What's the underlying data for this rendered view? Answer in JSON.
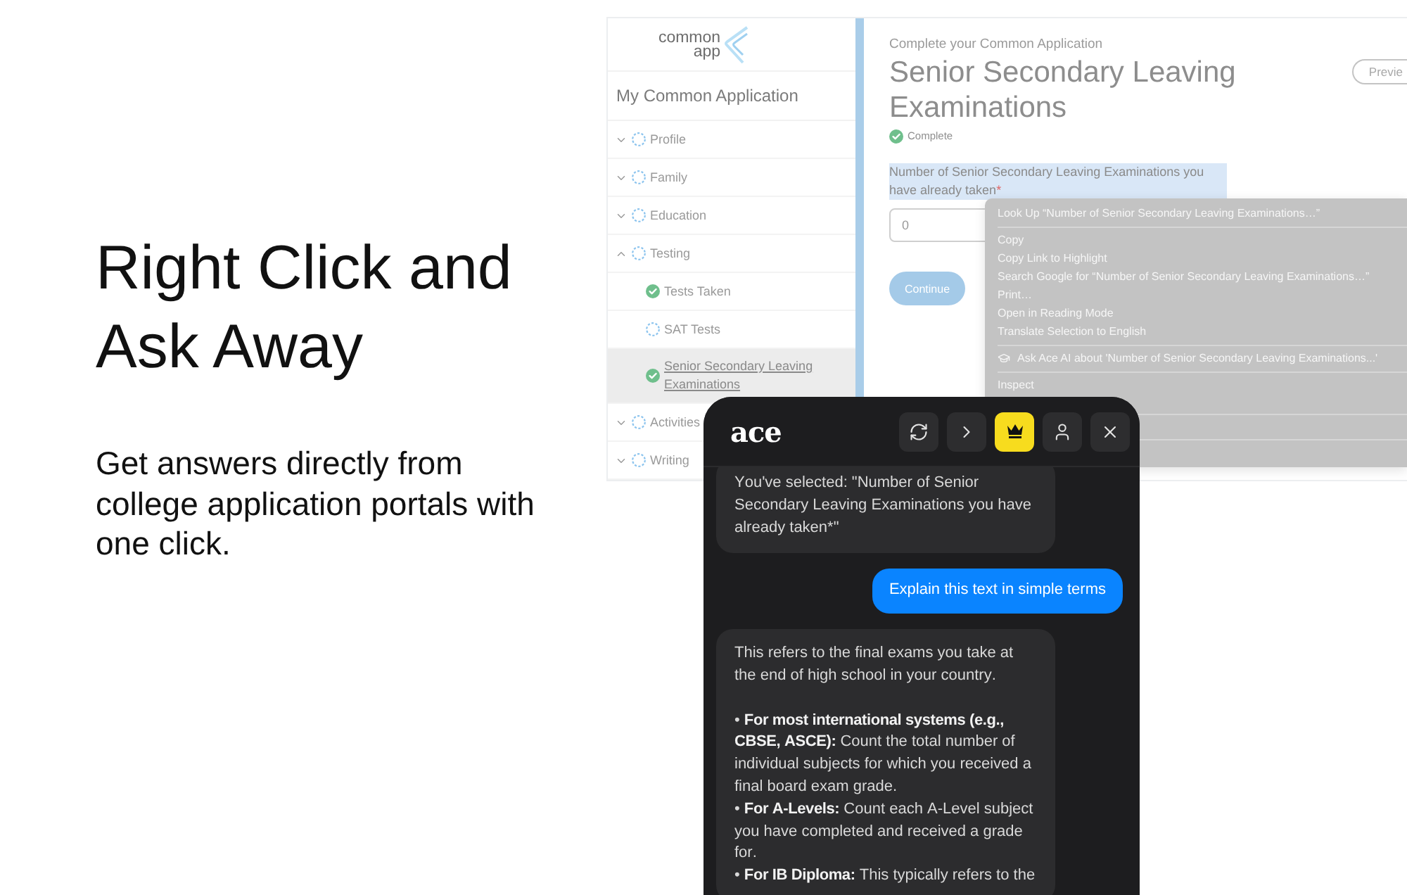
{
  "hero": {
    "title": "Right Click and Ask Away",
    "subtitle": "Get answers directly from college application portals with one click."
  },
  "portal": {
    "logo": [
      "common",
      "app"
    ],
    "sidebar": {
      "title": "My Common Application",
      "items": [
        {
          "label": "Profile",
          "expanded": false,
          "complete": false,
          "selected": false
        },
        {
          "label": "Family",
          "expanded": false,
          "complete": false,
          "selected": false
        },
        {
          "label": "Education",
          "expanded": false,
          "complete": false,
          "selected": false
        },
        {
          "label": "Testing",
          "expanded": true,
          "complete": false,
          "selected": false,
          "children": [
            {
              "label": "Tests Taken",
              "complete": true,
              "selected": false
            },
            {
              "label": "SAT Tests",
              "complete": false,
              "selected": false
            },
            {
              "label": "Senior Secondary Leaving Examinations",
              "complete": true,
              "selected": true
            }
          ]
        },
        {
          "label": "Activities",
          "expanded": false,
          "complete": false,
          "selected": false
        },
        {
          "label": "Writing",
          "expanded": false,
          "complete": false,
          "selected": false
        }
      ]
    },
    "page": {
      "kicker": "Complete your Common Application",
      "title": "Senior Secondary Leaving Examinations",
      "status": {
        "label": "Complete",
        "complete": true
      },
      "preview_button": "Previe",
      "question": {
        "label": "Number of Senior Secondary Leaving Examinations you have already taken",
        "required_mark": "*",
        "highlighted": true,
        "value": "0"
      },
      "continue_button": "Continue"
    }
  },
  "context_menu": {
    "groups": [
      [
        {
          "kind": "text",
          "label": "Look Up “Number of Senior Secondary Leaving Examinations…”"
        }
      ],
      [
        {
          "kind": "text",
          "label": "Copy"
        },
        {
          "kind": "text",
          "label": "Copy Link to Highlight"
        },
        {
          "kind": "text",
          "label": "Search Google for “Number of Senior Secondary Leaving Examinations…”"
        },
        {
          "kind": "text",
          "label": "Print…"
        },
        {
          "kind": "text",
          "label": "Open in Reading Mode"
        },
        {
          "kind": "text",
          "label": "Translate Selection to English"
        }
      ],
      [
        {
          "kind": "assistant",
          "label": "Ask Ace AI about 'Number of Senior Secondary Leaving Examinations...'"
        }
      ],
      [
        {
          "kind": "text",
          "label": "Inspect"
        }
      ]
    ]
  },
  "chat": {
    "logo": "ace",
    "header_buttons": [
      {
        "kind": "refresh",
        "highlighted": false
      },
      {
        "kind": "forward",
        "highlighted": false
      },
      {
        "kind": "crown",
        "highlighted": true
      },
      {
        "kind": "account",
        "highlighted": false
      },
      {
        "kind": "close",
        "highlighted": false
      }
    ],
    "messages": [
      {
        "kind": "assistant",
        "text": "You've selected: \"Number of Senior Secondary Leaving Examinations you have already taken*\""
      },
      {
        "kind": "user",
        "text": "Explain this text in simple terms"
      },
      {
        "kind": "assistant",
        "text": "This refers to the final exams you take at the end of high school in your country.",
        "bullets": [
          "• **For most international systems (e.g., CBSE, ASCE):** Count the total number of individual subjects for which you received a final board exam grade.",
          "• **For A-Levels:** Count each A-Level subject you have completed and received a grade for.",
          "• **For IB Diploma:** This typically refers to the"
        ]
      }
    ]
  }
}
